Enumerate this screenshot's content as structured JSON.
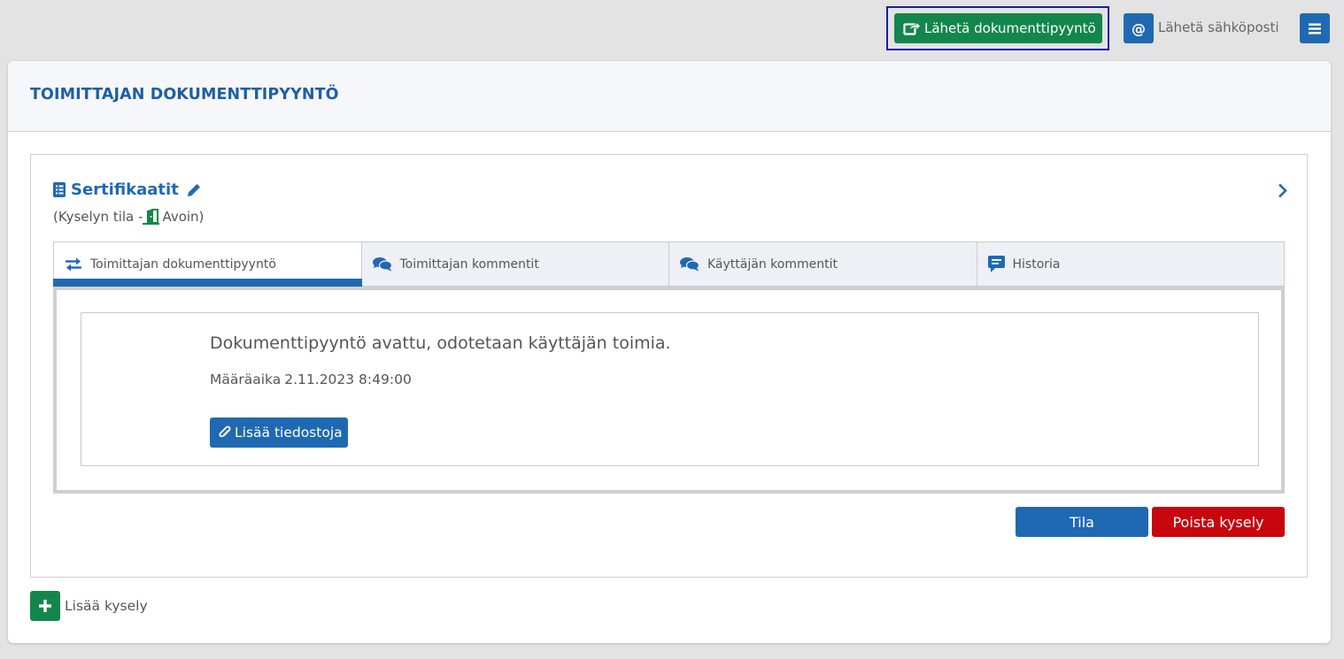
{
  "topbar": {
    "send_doc_label": "Lähetä dokumenttipyyntö",
    "email_icon_text": "@",
    "email_label": "Lähetä sähköposti",
    "menu_icon": "hamburger-icon"
  },
  "page": {
    "title": "TOIMITTAJAN DOKUMENTTIPYYNTÖ"
  },
  "survey": {
    "title": "Sertifikaatit",
    "status_prefix": "(Kyselyn tila -",
    "status_value": "Avoin)",
    "tabs": [
      {
        "label": "Toimittajan dokumenttipyyntö",
        "icon": "exchange-arrows-icon",
        "active": true
      },
      {
        "label": "Toimittajan kommentit",
        "icon": "comments-icon",
        "active": false
      },
      {
        "label": "Käyttäjän kommentit",
        "icon": "comments-icon",
        "active": false
      },
      {
        "label": "Historia",
        "icon": "message-icon",
        "active": false
      }
    ],
    "message": "Dokumenttipyyntö avattu, odotetaan käyttäjän toimia.",
    "deadline_label": "Määräaika",
    "deadline_value": "2.11.2023 8:49:00",
    "add_files_label": "Lisää tiedostoja",
    "state_button": "Tila",
    "delete_button": "Poista kysely"
  },
  "footer": {
    "add_survey_label": "Lisää kysely"
  },
  "colors": {
    "primary_blue": "#1f69b2",
    "green": "#13874b",
    "red": "#c8060e",
    "title_blue": "#1d5fa3"
  }
}
